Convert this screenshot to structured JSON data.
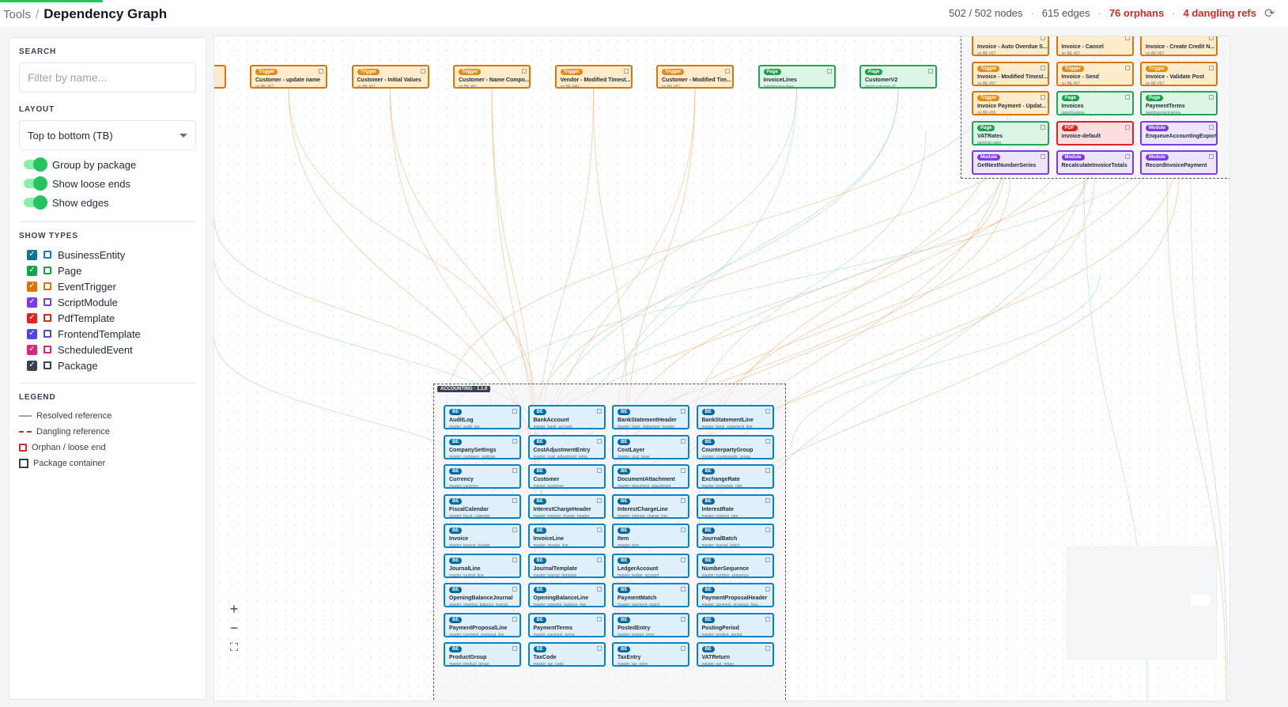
{
  "header": {
    "crumb_parent": "Tools",
    "title": "Dependency Graph",
    "nodes": "502 / 502 nodes",
    "edges": "615 edges",
    "orphans": "76 orphans",
    "dangling": "4 dangling refs",
    "progress_fraction": 0.08
  },
  "sidebar": {
    "search_title": "SEARCH",
    "search_placeholder": "Filter by name...",
    "layout_title": "LAYOUT",
    "layout_value": "Top to bottom (TB)",
    "toggles": [
      {
        "label": "Group by package",
        "on": true
      },
      {
        "label": "Show loose ends",
        "on": true
      },
      {
        "label": "Show edges",
        "on": true
      }
    ],
    "types_title": "SHOW TYPES",
    "types": [
      {
        "label": "BusinessEntity",
        "checked": true,
        "check_color": "#0e7490",
        "square_color": "#0284c7"
      },
      {
        "label": "Page",
        "checked": true,
        "check_color": "#16a34a",
        "square_color": "#16a34a"
      },
      {
        "label": "EventTrigger",
        "checked": true,
        "check_color": "#d97706",
        "square_color": "#d97706"
      },
      {
        "label": "ScriptModule",
        "checked": true,
        "check_color": "#7c3aed",
        "square_color": "#7c3aed"
      },
      {
        "label": "PdfTemplate",
        "checked": true,
        "check_color": "#dc2626",
        "square_color": "#dc2626"
      },
      {
        "label": "FrontendTemplate",
        "checked": true,
        "check_color": "#4f46e5",
        "square_color": "#4f46e5"
      },
      {
        "label": "ScheduledEvent",
        "checked": true,
        "check_color": "#db2777",
        "square_color": "#db2777"
      },
      {
        "label": "Package",
        "checked": true,
        "check_color": "#374151",
        "square_color": "#374151"
      }
    ],
    "legend_title": "LEGEND",
    "legend": [
      "Resolved reference",
      "Dangling reference",
      "Orphan / loose end",
      "Package container"
    ]
  },
  "graph": {
    "top_row": [
      {
        "badge": "Trigger",
        "name": "Customer - update name",
        "sub": "on BE #61",
        "kind": "trigger"
      },
      {
        "badge": "Trigger",
        "name": "Customer - Initial Values",
        "sub": "on BE #61",
        "kind": "trigger"
      },
      {
        "badge": "Trigger",
        "name": "Customer - Name Compo...",
        "sub": "on BE #61",
        "kind": "trigger"
      },
      {
        "badge": "Trigger",
        "name": "Vendor - Modified Timest...",
        "sub": "on BE #49",
        "kind": "trigger"
      },
      {
        "badge": "Trigger",
        "name": "Customer - Modified Tim...",
        "sub": "on BE #61",
        "kind": "trigger"
      },
      {
        "badge": "Page",
        "name": "InvoiceLines",
        "sub": "/app/invoice-lines",
        "kind": "page"
      },
      {
        "badge": "Page",
        "name": "CustomerV2",
        "sub": "/app/customer-v2",
        "kind": "page"
      }
    ],
    "right_cluster": [
      {
        "badge": "",
        "name": "Invoice - Auto Overdue S...",
        "sub": "on BE #67",
        "kind": "trigger"
      },
      {
        "badge": "",
        "name": "Invoice - Cancel",
        "sub": "on BE #67",
        "kind": "trigger"
      },
      {
        "badge": "",
        "name": "Invoice - Create Credit N...",
        "sub": "on BE #67",
        "kind": "trigger"
      },
      {
        "badge": "Trigger",
        "name": "Invoice - Modified Timest...",
        "sub": "on BE #67",
        "kind": "trigger"
      },
      {
        "badge": "Trigger",
        "name": "Invoice - Send",
        "sub": "on BE #67",
        "kind": "trigger"
      },
      {
        "badge": "Trigger",
        "name": "Invoice - Validate Post",
        "sub": "on BE #67",
        "kind": "trigger"
      },
      {
        "badge": "Trigger",
        "name": "Invoice Payment - Updat...",
        "sub": "on BE #65",
        "kind": "trigger"
      },
      {
        "badge": "Page",
        "name": "Invoices",
        "sub": "/app/invoices",
        "kind": "page"
      },
      {
        "badge": "Page",
        "name": "PaymentTerms",
        "sub": "/app/payment-terms",
        "kind": "page"
      },
      {
        "badge": "Page",
        "name": "VATRates",
        "sub": "/app/vat-rates",
        "kind": "page"
      },
      {
        "badge": "PDF",
        "name": "invoice-default",
        "sub": "",
        "kind": "pdf"
      },
      {
        "badge": "Module",
        "name": "EnqueueAccountingExport",
        "sub": "",
        "kind": "module"
      },
      {
        "badge": "Module",
        "name": "GetNextNumberSeries",
        "sub": "",
        "kind": "module"
      },
      {
        "badge": "Module",
        "name": "RecalculateInvoiceTotals",
        "sub": "",
        "kind": "module"
      },
      {
        "badge": "Module",
        "name": "RecordInvoicePayment",
        "sub": "",
        "kind": "module"
      }
    ],
    "package_label": "ACCOUNTING · 1.1.0",
    "entity_badge": "BE",
    "entities": [
      {
        "name": "AuditLog",
        "sub": "master: audit_log"
      },
      {
        "name": "BankAccount",
        "sub": "master: bank_account"
      },
      {
        "name": "BankStatementHeader",
        "sub": "master: bank_statement_header"
      },
      {
        "name": "BankStatementLine",
        "sub": "master: bank_statement_line"
      },
      {
        "name": "CompanySettings",
        "sub": "master: company_settings"
      },
      {
        "name": "CostAdjustmentEntry",
        "sub": "master: cost_adjustment_entry"
      },
      {
        "name": "CostLayer",
        "sub": "master: cost_layer"
      },
      {
        "name": "CounterpartyGroup",
        "sub": "master: counterparty_group"
      },
      {
        "name": "Currency",
        "sub": "master: currency"
      },
      {
        "name": "Customer",
        "sub": "master: customer"
      },
      {
        "name": "DocumentAttachment",
        "sub": "master: document_attachment"
      },
      {
        "name": "ExchangeRate",
        "sub": "master: exchange_rate"
      },
      {
        "name": "FiscalCalendar",
        "sub": "master: fiscal_calendar"
      },
      {
        "name": "InterestChargeHeader",
        "sub": "master: interest_charge_header"
      },
      {
        "name": "InterestChargeLine",
        "sub": "master: interest_charge_line"
      },
      {
        "name": "InterestRate",
        "sub": "master: interest_rate"
      },
      {
        "name": "Invoice",
        "sub": "master: invoice_header"
      },
      {
        "name": "InvoiceLine",
        "sub": "master: invoice_line"
      },
      {
        "name": "Item",
        "sub": "master: item"
      },
      {
        "name": "JournalBatch",
        "sub": "master: journal_batch"
      },
      {
        "name": "JournalLine",
        "sub": "master: journal_line"
      },
      {
        "name": "JournalTemplate",
        "sub": "master: journal_template"
      },
      {
        "name": "LedgerAccount",
        "sub": "master: ledger_account"
      },
      {
        "name": "NumberSequence",
        "sub": "master: number_sequence"
      },
      {
        "name": "OpeningBalanceJournal",
        "sub": "master: opening_balance_journal"
      },
      {
        "name": "OpeningBalanceLine",
        "sub": "master: opening_balance_line"
      },
      {
        "name": "PaymentMatch",
        "sub": "master: payment_match"
      },
      {
        "name": "PaymentProposalHeader",
        "sub": "master: payment_proposal_hea..."
      },
      {
        "name": "PaymentProposalLine",
        "sub": "master: payment_proposal_line"
      },
      {
        "name": "PaymentTerms",
        "sub": "master: payment_terms"
      },
      {
        "name": "PostedEntry",
        "sub": "master: posted_entry"
      },
      {
        "name": "PostingPeriod",
        "sub": "master: posting_period"
      },
      {
        "name": "ProductGroup",
        "sub": "master: product_group"
      },
      {
        "name": "TaxCode",
        "sub": "master: tax_code"
      },
      {
        "name": "TaxEntry",
        "sub": "master: tax_entry"
      },
      {
        "name": "VATReturn",
        "sub": "master: vat_return"
      }
    ]
  },
  "zoom": {
    "in": "+",
    "out": "−",
    "fit": "⛶"
  },
  "colors": {
    "trigger": {
      "border": "#d97706",
      "bg": "#fdeccb",
      "badge": "#e38b12"
    },
    "page": {
      "border": "#22a559",
      "bg": "#dcf5e5",
      "badge": "#16a34a"
    },
    "pdf": {
      "border": "#dc2626",
      "bg": "#fcdede",
      "badge": "#dc2626"
    },
    "module": {
      "border": "#7c3aed",
      "bg": "#ede5fc",
      "badge": "#7c3aed"
    },
    "entity": {
      "border": "#0284c7",
      "bg": "#dff0fb",
      "badge": "#0369a1"
    }
  }
}
